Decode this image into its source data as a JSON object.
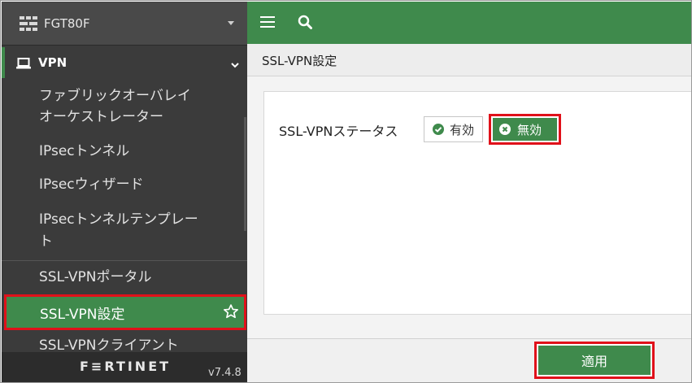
{
  "device": {
    "name": "FGT80F"
  },
  "nav": {
    "section": "VPN",
    "items": [
      {
        "label": "ファブリックオーバレイ"
      },
      {
        "label": "オーケストレーター"
      },
      {
        "label": "IPsecトンネル"
      },
      {
        "label": "IPsecウィザード"
      },
      {
        "label": "IPsecトンネルテンプレー"
      },
      {
        "label": "ト"
      },
      {
        "label": "SSL-VPNポータル"
      },
      {
        "label": "SSL-VPN設定"
      },
      {
        "label": "SSL-VPNクライアント"
      }
    ]
  },
  "footer": {
    "brand": "F≡RTINET",
    "version": "v7.4.8"
  },
  "page": {
    "title": "SSL-VPN設定"
  },
  "form": {
    "status_label": "SSL-VPNステータス",
    "enabled_label": "有効",
    "disabled_label": "無効",
    "selected": "disabled"
  },
  "actions": {
    "apply_label": "適用"
  },
  "colors": {
    "brand_green": "#3f8a4c",
    "highlight_red": "#e0111a",
    "sidebar_bg": "#3b3b3b"
  },
  "icons": {
    "device": "fortigate-icon",
    "caret": "caret-down-icon",
    "section": "laptop-icon",
    "collapse": "chevron-down-icon",
    "favorite": "star-icon",
    "menu": "hamburger-icon",
    "search": "search-icon",
    "enabled": "check-circle-icon",
    "disabled": "x-circle-icon"
  }
}
